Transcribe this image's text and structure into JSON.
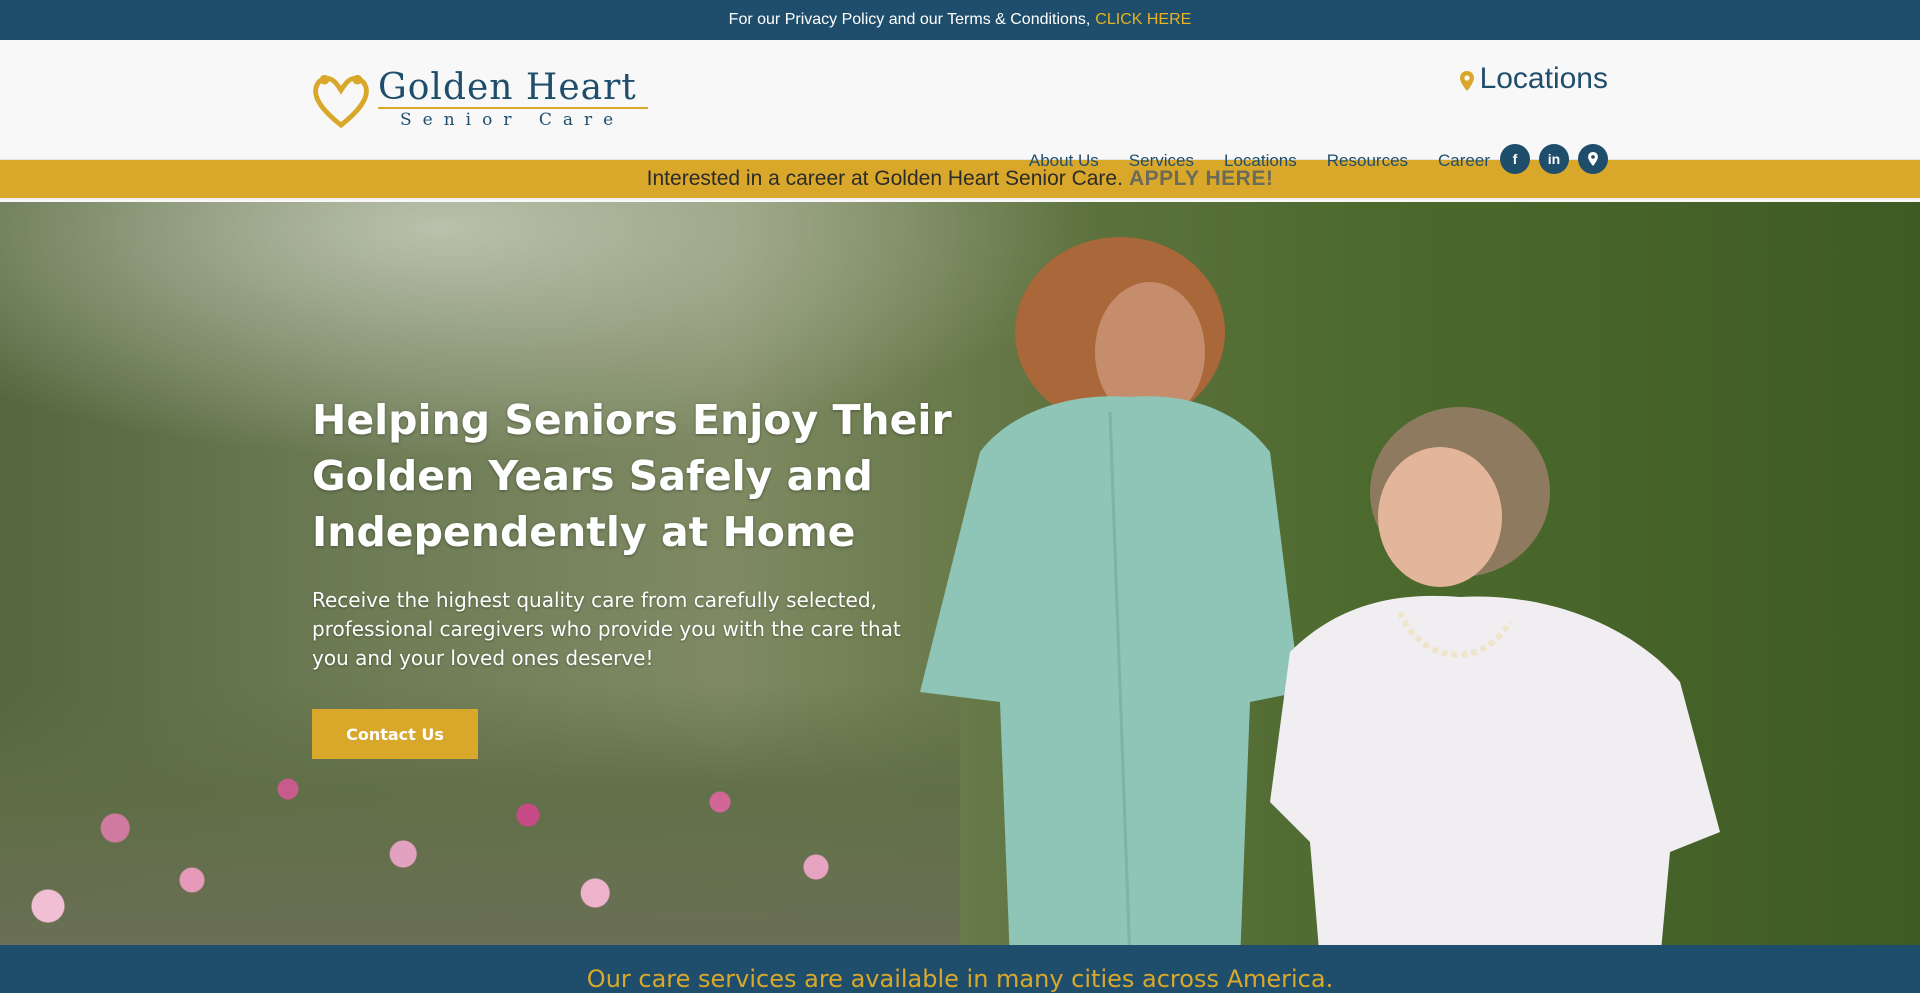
{
  "topbar": {
    "text": "For our Privacy Policy and our Terms & Conditions,",
    "link": "CLICK HERE"
  },
  "logo": {
    "line1": "Golden Heart",
    "line2": "Senior Care"
  },
  "header": {
    "locations_label": "Locations"
  },
  "nav": {
    "items": [
      "About Us",
      "Services",
      "Locations",
      "Resources",
      "Career"
    ]
  },
  "social": {
    "facebook": "f",
    "linkedin": "in",
    "facebook_icon": "facebook-icon",
    "linkedin_icon": "linkedin-icon",
    "location_icon": "map-pin-icon"
  },
  "career_bar": {
    "text": "Interested in a career at Golden Heart Senior Care.",
    "link": "APPLY HERE!"
  },
  "hero": {
    "title": "Helping Seniors Enjoy Their Golden Years Safely and Independently at Home",
    "subtitle": "Receive the highest quality care from carefully selected, professional caregivers who provide you with the care that you and your loved ones deserve!",
    "cta": "Contact Us"
  },
  "bottom_bar": {
    "text": "Our care services are available in many cities across America."
  },
  "colors": {
    "navy": "#1f4e6c",
    "gold": "#d9a82b"
  }
}
